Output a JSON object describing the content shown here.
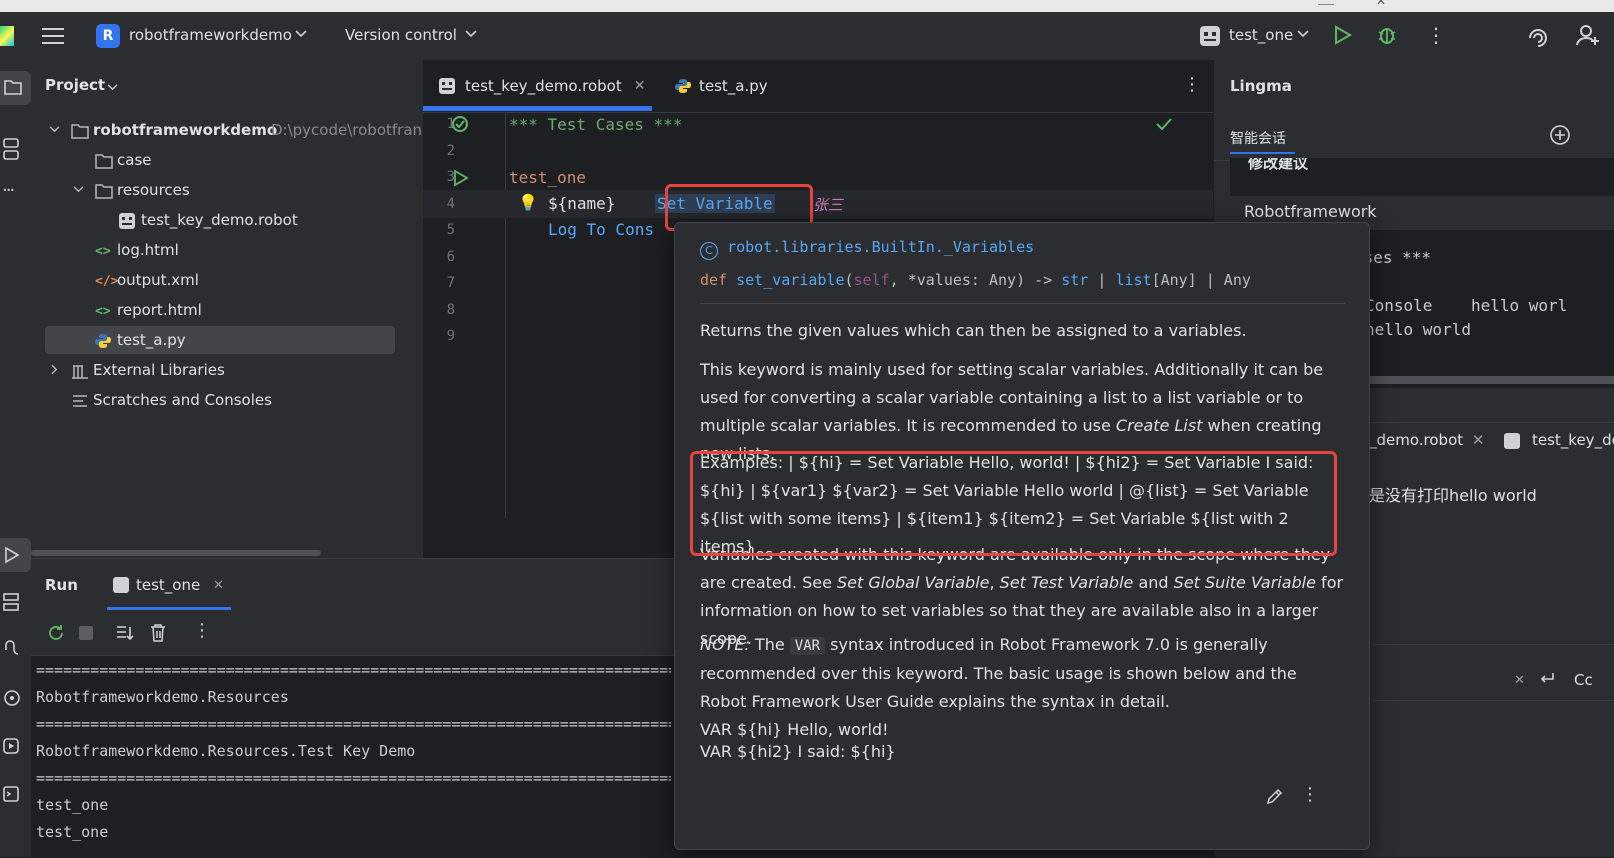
{
  "titlebar": {
    "project_badge": "R",
    "project_name": "robotframeworkdemo",
    "vcs_menu": "Version control",
    "run_config": "test_one"
  },
  "project_panel": {
    "title": "Project",
    "items": [
      {
        "label": "robotframeworkdemo",
        "sub": "D:\\pycode\\robotfran",
        "type": "folder",
        "indent": 0,
        "expanded": true
      },
      {
        "label": "case",
        "type": "folder",
        "indent": 1
      },
      {
        "label": "resources",
        "type": "folder",
        "indent": 1,
        "expanded": true
      },
      {
        "label": "test_key_demo.robot",
        "type": "robot",
        "indent": 2
      },
      {
        "label": "log.html",
        "type": "html",
        "indent": 1
      },
      {
        "label": "output.xml",
        "type": "xml",
        "indent": 1
      },
      {
        "label": "report.html",
        "type": "html",
        "indent": 1
      },
      {
        "label": "test_a.py",
        "type": "python",
        "indent": 1,
        "selected": true
      },
      {
        "label": "External Libraries",
        "type": "library",
        "indent": 0
      },
      {
        "label": "Scratches and Consoles",
        "type": "scratch",
        "indent": 0
      }
    ]
  },
  "editor": {
    "tabs": [
      {
        "label": "test_key_demo.robot",
        "active": true
      },
      {
        "label": "test_a.py",
        "active": false
      }
    ],
    "line_numbers": [
      "1",
      "2",
      "3",
      "4",
      "5",
      "6",
      "7",
      "8",
      "9"
    ],
    "code": {
      "line1": "*** Test Cases ***",
      "line3": "test_one",
      "line4_var": "${name}",
      "line4_keyword": "Set Variable",
      "line4_value": "张三",
      "line5": "Log To Cons"
    }
  },
  "doc_popup": {
    "class_path": "robot.libraries.BuiltIn._Variables",
    "sig_def": "def",
    "sig_name": "set_variable",
    "sig_self": "self",
    "sig_rest1": ", *values: Any) -> ",
    "sig_str": "str",
    "sig_pipe1": " | ",
    "sig_list": "list",
    "sig_rest2": "[Any] | Any",
    "p1": "Returns the given values which can then be assigned to a variables.",
    "p2_a": "This keyword is mainly used for setting scalar variables. Additionally it can be used for converting a scalar variable containing a list to a list variable or to multiple scalar variables. It is recommended to use ",
    "p2_link": "Create List",
    "p2_b": " when creating new lists.",
    "examples": "Examples: | ${hi} = Set Variable Hello, world! | ${hi2} = Set Variable I said: ${hi} | ${var1} ${var2} = Set Variable Hello world | @{list} = Set Variable ${list with some items} | ${item1} ${item2} = Set Variable ${list with 2 items}",
    "p3_a": "Variables created with this keyword are available only in the scope where they are created. See ",
    "p3_l1": "Set Global Variable",
    "p3_c1": ", ",
    "p3_l2": "Set Test Variable",
    "p3_and": " and ",
    "p3_l3": "Set Suite Variable",
    "p3_b": " for information on how to set variables so that they are available also in a larger scope.",
    "note_label": "NOTE:",
    "note_a": " The ",
    "note_code": "VAR",
    "note_b": " syntax introduced in Robot Framework 7.0 is generally recommended over this keyword. The basic usage is shown below and the Robot Framework User Guide explains the syntax in detail.",
    "var_line1": "VAR ${hi} Hello, world!",
    "var_line2": "VAR ${hi2} I said: ${hi}"
  },
  "lingma": {
    "title": "Lingma",
    "tab": "智能会话",
    "section_heading": "修改建议",
    "code_header": "Robotframework",
    "code_l1": "ases ***",
    "code_l2": "Console    hello worl",
    "code_l3": "hello world",
    "file_tab1": "_demo.robot",
    "file_tab2": "test_key_de",
    "question": "是没有打印hello world",
    "cc": "Cc"
  },
  "run_panel": {
    "title": "Run",
    "tab": "test_one",
    "console": [
      "==============================================================================",
      "Robotframeworkdemo.Resources",
      "==============================================================================",
      "Robotframeworkdemo.Resources.Test Key Demo",
      "==============================================================================",
      "test_one",
      "test_one"
    ]
  },
  "colors": {
    "accent": "#3574f0",
    "highlight_box": "#e5443f",
    "keyword": "#56a8f5",
    "section": "#6aab73",
    "testname": "#cf8e6d",
    "value": "#c77dbb"
  }
}
